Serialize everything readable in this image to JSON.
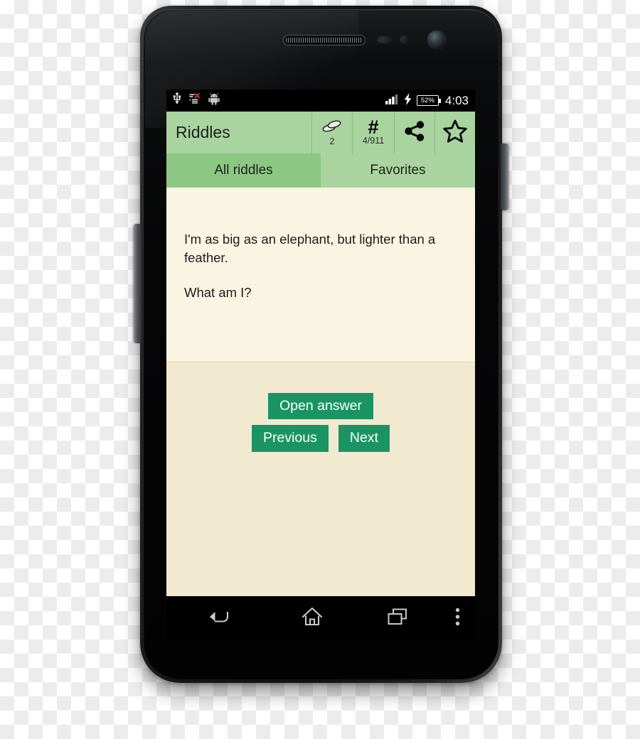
{
  "device": {
    "type": "android-smartphone",
    "hardware": {
      "earpiece": "earpiece-speaker",
      "proximity_sensor": "proximity-sensor",
      "light_sensor": "light-sensor",
      "front_camera": "front-camera",
      "volume_rocker": "volume-rocker",
      "power_button": "power-button"
    }
  },
  "status_bar": {
    "left_icons": [
      "usb-icon",
      "sync-error-icon",
      "android-icon"
    ],
    "signal_icon": "signal-bars-icon",
    "charging_icon": "charging-bolt-icon",
    "battery_level": "52%",
    "time": "4:03"
  },
  "app_bar": {
    "title": "Riddles",
    "actions": [
      {
        "icon": "coins-icon",
        "label": "2",
        "name": "coins-action"
      },
      {
        "icon": "hash-icon",
        "glyph": "#",
        "label": "4/911",
        "name": "riddle-counter-action"
      },
      {
        "icon": "share-icon",
        "label": "",
        "name": "share-action"
      },
      {
        "icon": "star-outline-icon",
        "label": "",
        "name": "favorite-action"
      }
    ]
  },
  "tabs": [
    {
      "label": "All riddles",
      "selected": true
    },
    {
      "label": "Favorites",
      "selected": false
    }
  ],
  "content": {
    "riddle_text": "I'm as big as an elephant, but lighter than a feather.",
    "riddle_question": "What am I?",
    "buttons": {
      "open_answer": "Open answer",
      "previous": "Previous",
      "next": "Next"
    }
  },
  "nav_bar": {
    "back": "back-icon",
    "home": "home-icon",
    "recents": "recent-apps-icon",
    "menu": "overflow-menu-icon"
  },
  "colors": {
    "app_bar_green": "#a9d49f",
    "tab_selected_green": "#8cc882",
    "button_green": "#1a9463",
    "paper_top": "#faf5e2",
    "paper_bottom": "#f2ead0",
    "status_bar_black": "#000000"
  }
}
